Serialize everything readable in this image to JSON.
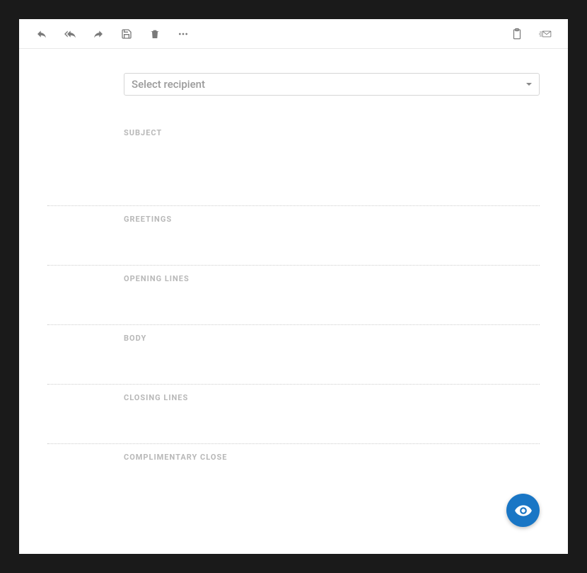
{
  "toolbar": {
    "reply": "Reply",
    "reply_all": "Reply All",
    "forward": "Forward",
    "save": "Save",
    "delete": "Delete",
    "more": "More",
    "clipboard": "Clipboard",
    "send": "Send"
  },
  "recipient": {
    "placeholder": "Select recipient"
  },
  "sections": {
    "subject": {
      "label": "SUBJECT"
    },
    "greetings": {
      "label": "GREETINGS"
    },
    "opening_lines": {
      "label": "OPENING LINES"
    },
    "body": {
      "label": "BODY"
    },
    "closing_lines": {
      "label": "CLOSING LINES"
    },
    "complimentary_close": {
      "label": "COMPLIMENTARY CLOSE"
    }
  },
  "fab": {
    "label": "Preview"
  },
  "colors": {
    "accent": "#1976c5",
    "muted_text": "#b8b8b8",
    "border": "#d6d6d6"
  }
}
